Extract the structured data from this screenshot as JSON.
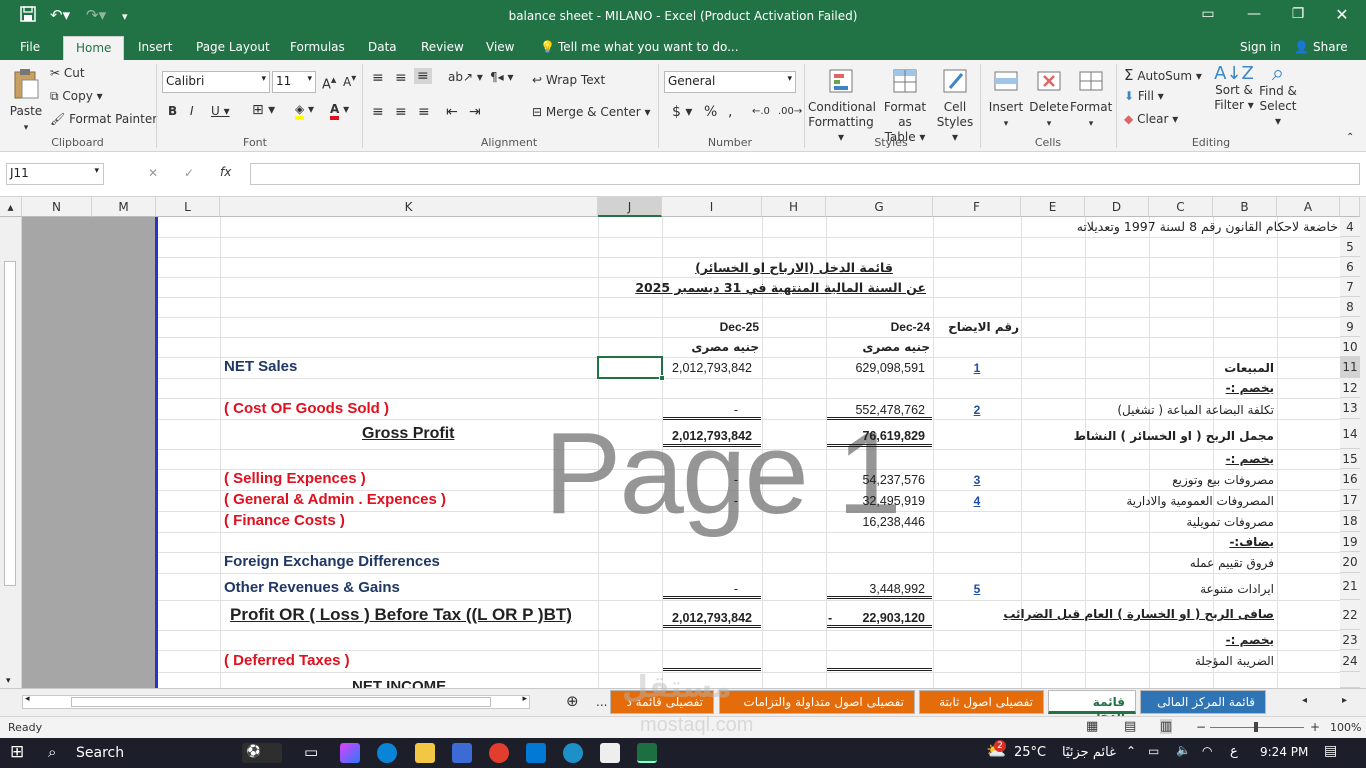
{
  "window": {
    "title": "balance sheet - MILANO - Excel (Product Activation Failed)"
  },
  "ribbon_tabs": [
    "File",
    "Home",
    "Insert",
    "Page Layout",
    "Formulas",
    "Data",
    "Review",
    "View"
  ],
  "tell_me": "Tell me what you want to do...",
  "sign_in": "Sign in",
  "share": "Share",
  "clipboard": {
    "paste": "Paste",
    "cut": "Cut",
    "copy": "Copy",
    "format_painter": "Format Painter",
    "group": "Clipboard"
  },
  "font": {
    "name": "Calibri",
    "size": "11",
    "group": "Font"
  },
  "alignment": {
    "wrap": "Wrap Text",
    "merge": "Merge & Center",
    "group": "Alignment"
  },
  "number": {
    "format": "General",
    "group": "Number"
  },
  "styles": {
    "cond1": "Conditional",
    "cond2": "Formatting",
    "fmt1": "Format as",
    "fmt2": "Table",
    "cell1": "Cell",
    "cell2": "Styles",
    "group": "Styles"
  },
  "cells": {
    "insert": "Insert",
    "delete": "Delete",
    "format": "Format",
    "group": "Cells"
  },
  "editing": {
    "autosum": "AutoSum",
    "fill": "Fill",
    "clear": "Clear",
    "sort1": "Sort &",
    "sort2": "Filter",
    "find1": "Find &",
    "find2": "Select",
    "group": "Editing"
  },
  "namebox": "J11",
  "fx": "fx",
  "columns": [
    "N",
    "M",
    "L",
    "K",
    "J",
    "I",
    "H",
    "G",
    "F",
    "E",
    "D",
    "C",
    "B",
    "A"
  ],
  "rows": [
    "4",
    "5",
    "6",
    "7",
    "8",
    "9",
    "10",
    "11",
    "12",
    "13",
    "14",
    "15",
    "16",
    "17",
    "18",
    "19",
    "20",
    "21",
    "22",
    "23",
    "24"
  ],
  "watermark": "Page 1",
  "sheet": {
    "r4": "خاضعة لاحكام القانون رقم 8 لسنة 1997 وتعديلاته",
    "r6": "قائمة الدخل (الارباح او الخسائر)",
    "r7": "عن السنة المالية المنتهية في 31 ديسمبر 2025",
    "h_dec25": "Dec-25",
    "h_dec24": "Dec-24",
    "h_note": "رقم الايضاح",
    "cur1": "جنيه مصرى",
    "cur2": "جنيه مصرى",
    "net_sales": "NET Sales",
    "ns_i": "2,012,793,842",
    "ns_g": "629,098,591",
    "ns_f": "1",
    "ns_ar": "المبيعات",
    "deduct1": "يخصم :-",
    "cogs": "( Cost OF Goods Sold )",
    "cogs_i": "-",
    "cogs_g": "552,478,762",
    "cogs_f": "2",
    "cogs_ar": "تكلفة البضاعة المباعة ( تشغيل)",
    "gross": "Gross Profit",
    "gross_i": "2,012,793,842",
    "gross_g": "76,619,829",
    "gross_ar": "مجمل الربح ( او الخسائر ) النشاط",
    "deduct2": "يخصم :-",
    "selling": "( Selling Expences )",
    "sell_i": "-",
    "sell_g": "54,237,576",
    "sell_f": "3",
    "sell_ar": "مصروفات بيع وتوزيع",
    "gen": "( General & Admin . Expences )",
    "gen_i": "-",
    "gen_g": "32,495,919",
    "gen_f": "4",
    "gen_ar": "المصروفات العمومية والادارية",
    "fin": "( Finance Costs )",
    "fin_g": "16,238,446",
    "fin_ar": "مصروفات تمويلية",
    "add": "يضاف:-",
    "fx_diff": "Foreign Exchange Differences",
    "fx_ar": "فروق تقييم عمله",
    "other": "Other Revenues & Gains",
    "oth_i": "-",
    "oth_g": "3,448,992",
    "oth_f": "5",
    "oth_ar": "ايرادات متنوعة",
    "pbt": "Profit OR ( Loss ) Before Tax ((L OR P )BT)",
    "pbt_i": "2,012,793,842",
    "pbt_dash": "-",
    "pbt_g": "22,903,120",
    "pbt_ar": "صافى الربح ( او الخسارة ) العام قبل الضرائب",
    "deduct3": "يخصم :-",
    "deferred": "( Deferred Taxes )",
    "def_ar": "الضريبة المؤجلة",
    "net_income": "NET INCOME"
  },
  "sheet_tabs": [
    "قائمة المركز المالى",
    "قائمة الدخل",
    "تفصيلى اصول ثابتة",
    "تفصيلى اصول متداولة والتزامات",
    "تفصيلى قائمة د"
  ],
  "status": {
    "ready": "Ready",
    "zoom": "100%"
  },
  "taskbar": {
    "search": "Search",
    "temp": "25°C",
    "weather": "غائم جزئيًا",
    "time": "9:24 PM",
    "lang": "ع",
    "badge": "2"
  },
  "logo": {
    "text": "mostaql.com"
  },
  "colors": {
    "excel_green": "#217346",
    "tab_orange": "#e46c0a",
    "red_text": "#e0101e",
    "blue_text": "#1f3864"
  }
}
